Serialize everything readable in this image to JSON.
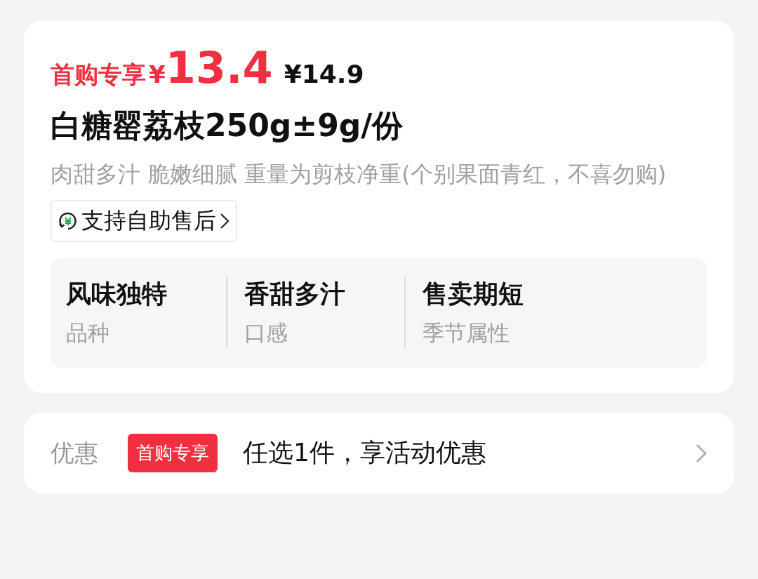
{
  "price": {
    "label": "首购专享",
    "currency": "¥",
    "amount": "13.4",
    "original": "¥14.9"
  },
  "title": "白糖罂荔枝250g±9g/份",
  "description": "肉甜多汁 脆嫩细腻 重量为剪枝净重(个别果面青红，不喜勿购)",
  "service_chip": {
    "label": "支持自助售后"
  },
  "attributes": [
    {
      "value": "风味独特",
      "label": "品种"
    },
    {
      "value": "香甜多汁",
      "label": "口感"
    },
    {
      "value": "售卖期短",
      "label": "季节属性"
    }
  ],
  "promotion": {
    "label": "优惠",
    "badge": "首购专享",
    "text": "任选1件，享活动优惠"
  }
}
